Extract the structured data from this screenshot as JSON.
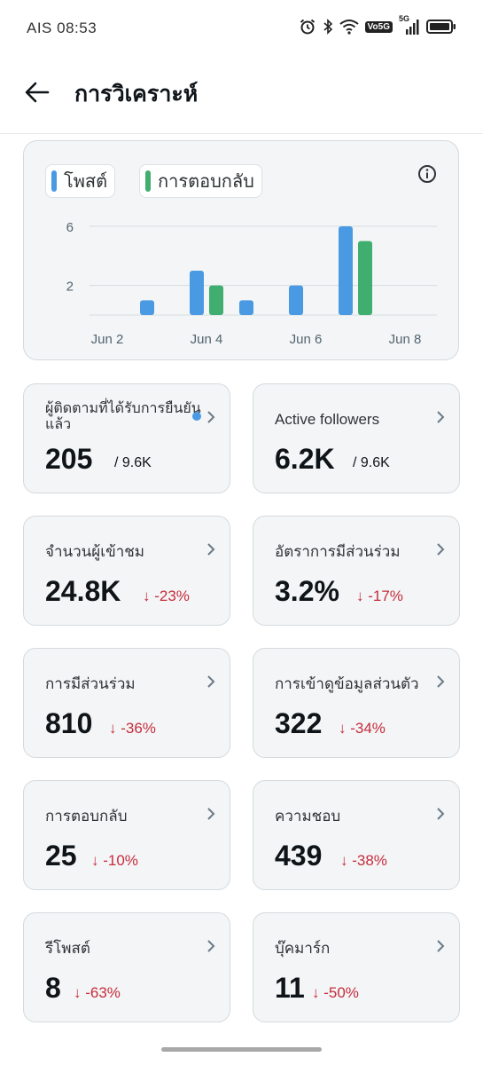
{
  "status_bar": {
    "carrier_time": "AIS 08:53",
    "volte": "Vo5G",
    "network": "5G"
  },
  "header": {
    "title": "การวิเคราะห์"
  },
  "chart": {
    "legend": [
      {
        "label": "โพสต์",
        "color": "#4a9ae3"
      },
      {
        "label": "การตอบกลับ",
        "color": "#3fae6f"
      }
    ]
  },
  "chart_data": {
    "type": "bar",
    "x_tick_labels": [
      "Jun 2",
      "Jun 4",
      "Jun 6",
      "Jun 8"
    ],
    "y_tick_labels": [
      "6",
      "2"
    ],
    "ylim": [
      0,
      6
    ],
    "grid": true,
    "legend_position": "top-left",
    "series": [
      {
        "name": "โพสต์",
        "color": "#4a9ae3",
        "values": [
          {
            "x": "Jun 3",
            "y": 1
          },
          {
            "x": "Jun 4",
            "y": 3
          },
          {
            "x": "Jun 5",
            "y": 1
          },
          {
            "x": "Jun 6",
            "y": 2
          },
          {
            "x": "Jun 7",
            "y": 6
          }
        ]
      },
      {
        "name": "การตอบกลับ",
        "color": "#3fae6f",
        "values": [
          {
            "x": "Jun 4",
            "y": 2
          },
          {
            "x": "Jun 7",
            "y": 5
          }
        ]
      }
    ]
  },
  "tiles": [
    {
      "label": "ผู้ติดตามที่ได้รับการยืนยันแล้ว",
      "value": "205",
      "sub": "/ 9.6K",
      "change": ""
    },
    {
      "label": "Active followers",
      "value": "6.2K",
      "sub": "/ 9.6K",
      "change": ""
    },
    {
      "label": "จำนวนผู้เข้าชม",
      "value": "24.8K",
      "sub": "",
      "change": "↓ -23%"
    },
    {
      "label": "อัตราการมีส่วนร่วม",
      "value": "3.2%",
      "sub": "",
      "change": "↓ -17%"
    },
    {
      "label": "การมีส่วนร่วม",
      "value": "810",
      "sub": "",
      "change": "↓ -36%"
    },
    {
      "label": "การเข้าดูข้อมูลส่วนตัว",
      "value": "322",
      "sub": "",
      "change": "↓ -34%"
    },
    {
      "label": "การตอบกลับ",
      "value": "25",
      "sub": "",
      "change": "↓ -10%"
    },
    {
      "label": "ความชอบ",
      "value": "439",
      "sub": "",
      "change": "↓ -38%"
    },
    {
      "label": "รีโพสต์",
      "value": "8",
      "sub": "",
      "change": "↓ -63%"
    },
    {
      "label": "บุ๊คมาร์ก",
      "value": "11",
      "sub": "",
      "change": "↓ -50%"
    }
  ]
}
